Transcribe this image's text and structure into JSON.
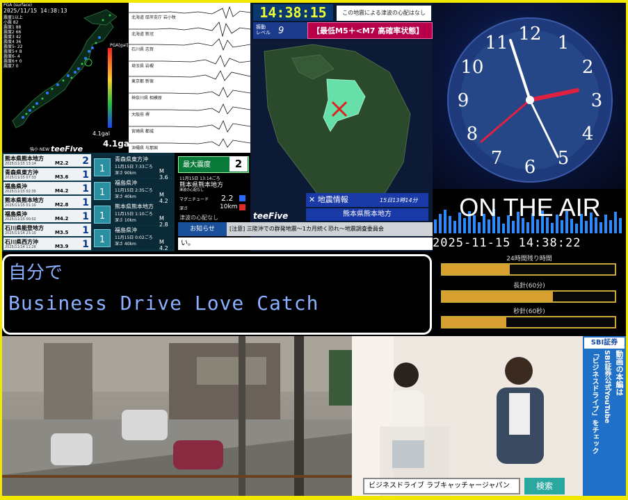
{
  "map_panel": {
    "header": "PGA (surface)",
    "timestamp": "2025/11/15 14:38:13",
    "stats": "震度1以上\n小震 82\n震度1 88\n震度2 66\n震度3 42\n震度4 36\n震度5- 22\n震度5+ 8\n震度6- 4\n震度6+ 0\n震度7 0",
    "pga_label": "PGA[gal]",
    "gal_value": "4.1gal",
    "gal_small": "4.1gal",
    "logo": "teeFive",
    "new_label": "強小 NEW"
  },
  "wave_panel": {
    "labels": [
      "北海道 厚岸支庁 岩小牧",
      "北海道 新冠",
      "石川県 志賀",
      "埼玉県 岩槻",
      "東京都 新宿",
      "神奈川県 相模原",
      "大阪府 堺",
      "宮崎県 都城",
      "沖縄県 与那国"
    ]
  },
  "quake_map": {
    "clock": "14:38:15",
    "no_tsunami": "この地震による津波の心配はなし",
    "level_label": "振動\nレベル",
    "level_value": "9",
    "forecast": "【最低M5＋<M7 高確率状態】",
    "info_label": "✕ 地震情報",
    "info_time": "15日13時14分",
    "region": "熊本県熊本地方",
    "logo": "teeFive"
  },
  "quake_list_left": [
    {
      "place": "熊本県熊本地方",
      "meta": "2025/11/15 13:14",
      "mag": "M2.2",
      "intensity": "2"
    },
    {
      "place": "青森県東方沖",
      "meta": "2025/11/15 07:33",
      "mag": "M3.6",
      "intensity": "1"
    },
    {
      "place": "福島県沖",
      "meta": "2025/11/15 02:35",
      "mag": "M4.2",
      "intensity": "1"
    },
    {
      "place": "熊本県熊本地方",
      "meta": "2025/11/15 01:10",
      "mag": "M2.8",
      "intensity": "1"
    },
    {
      "place": "福島県沖",
      "meta": "2025/11/15 00:02",
      "mag": "M4.2",
      "intensity": "1"
    },
    {
      "place": "石川県能登地方",
      "meta": "2025/11/14 23:10",
      "mag": "M3.5",
      "intensity": "1"
    },
    {
      "place": "石川県西方沖",
      "meta": "2025/11/14 11:26",
      "mag": "M3.9",
      "intensity": "1"
    }
  ],
  "quake_list_mid": [
    {
      "intensity": "1",
      "name": "青森県東方沖",
      "dt": "11月15日 7:33ごろ",
      "depth": "深さ 90km",
      "mag": "M 3.6"
    },
    {
      "intensity": "1",
      "name": "福島県沖",
      "dt": "11月15日 2:35ごろ",
      "depth": "深さ 40km",
      "mag": "M 4.2"
    },
    {
      "intensity": "1",
      "name": "熊本県熊本地方",
      "dt": "11月15日 1:10ごろ",
      "depth": "深さ 10km",
      "mag": "M 2.8"
    },
    {
      "intensity": "1",
      "name": "福島県沖",
      "dt": "11月15日 0:02ごろ",
      "depth": "深さ 40km",
      "mag": "M 4.2"
    }
  ],
  "detail": {
    "max_label": "最大震度",
    "max_value": "2",
    "time": "11月15日 13:14ごろ",
    "place": "熊本県熊本地方",
    "note": "津波の心配なし",
    "mag_label": "マグニチュード",
    "mag": "2.2",
    "depth_label": "深さ",
    "depth": "10km",
    "tsunami": "津波の心配なし"
  },
  "notice": {
    "label": "お知らせ",
    "text": "[注意] 三陸沖での群発地震〜1カ月続く恐れ〜地震調査委員会"
  },
  "ticker": "い。",
  "clock_panel": {
    "numbers": [
      "12",
      "1",
      "2",
      "3",
      "4",
      "5",
      "6",
      "7",
      "8",
      "9",
      "10",
      "11"
    ],
    "on_air": "ON THE AIR",
    "datetime": "2025-11-15 14:38:22",
    "bars": [
      {
        "label": "24時間残り時間",
        "fill": 0.39
      },
      {
        "label": "長針(60分)",
        "fill": 0.64
      },
      {
        "label": "秒針(60秒)",
        "fill": 0.37
      }
    ]
  },
  "subtitle": {
    "line1": "自分で",
    "line2": "Business Drive Love Catch"
  },
  "studio": {
    "search_text": "ビジネスドライブ ラブキャッチャージャパン",
    "search_button": "検索",
    "sbi_logo": "SBI証券",
    "sbi_text1": "動画の本編は",
    "sbi_text2": "SBI証券公式YouTube",
    "sbi_text3": "「ビジネスドライブ」をチェック"
  }
}
